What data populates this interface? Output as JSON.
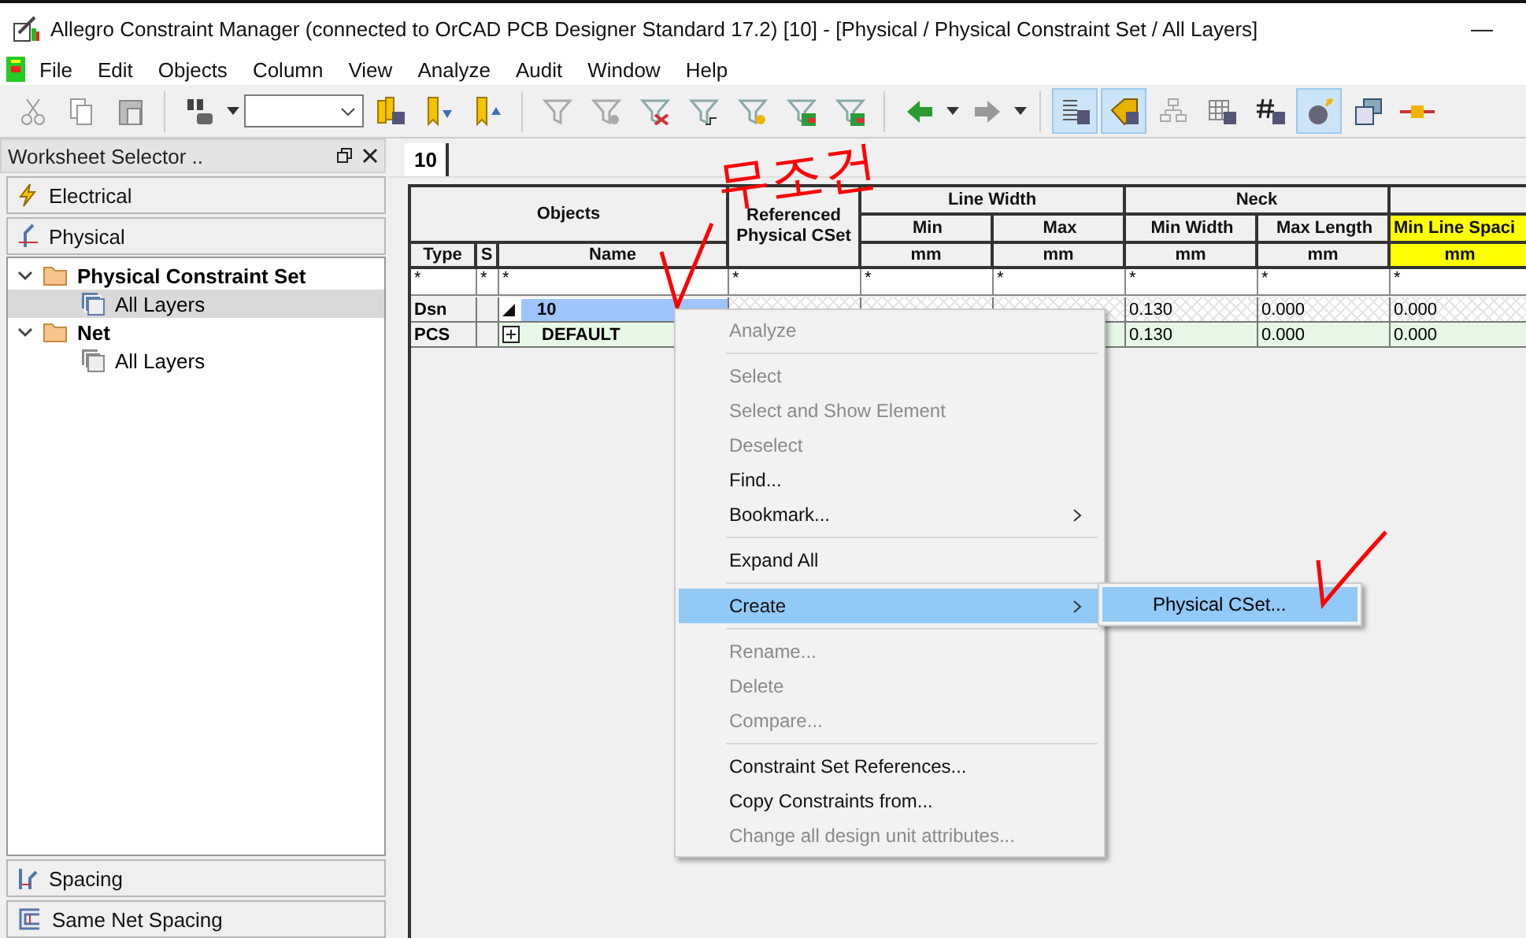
{
  "window": {
    "title": "Allegro Constraint Manager (connected to OrCAD PCB Designer Standard 17.2) [10] - [Physical / Physical Constraint Set / All Layers]",
    "minimize": "—"
  },
  "menu": [
    "File",
    "Edit",
    "Objects",
    "Column",
    "View",
    "Analyze",
    "Audit",
    "Window",
    "Help"
  ],
  "toolbar": [
    [
      {
        "kind": "cut",
        "pressed": false
      },
      {
        "kind": "copy",
        "pressed": false
      },
      {
        "kind": "paste",
        "pressed": false
      }
    ],
    [
      {
        "kind": "find",
        "pressed": false,
        "dropdown": true
      },
      {
        "kind": "combo"
      },
      {
        "kind": "bookmarks",
        "pressed": false
      },
      {
        "kind": "bookmarkdown",
        "pressed": false
      },
      {
        "kind": "bookmarkup",
        "pressed": false
      }
    ],
    [
      {
        "kind": "filter",
        "pressed": false
      },
      {
        "kind": "filterx",
        "pressed": false
      },
      {
        "kind": "filterred",
        "pressed": false
      },
      {
        "kind": "filterstep",
        "pressed": false
      },
      {
        "kind": "filterstar",
        "pressed": false
      },
      {
        "kind": "filtergrid",
        "pressed": false
      },
      {
        "kind": "filtergrid",
        "pressed": false
      }
    ],
    [
      {
        "kind": "back",
        "pressed": false,
        "dropdown": true
      },
      {
        "kind": "forward",
        "pressed": false,
        "dropdown": true
      }
    ],
    [
      {
        "kind": "sheet",
        "pressed": true
      },
      {
        "kind": "tag",
        "pressed": true
      },
      {
        "kind": "tree",
        "pressed": false
      },
      {
        "kind": "table",
        "pressed": false
      },
      {
        "kind": "hash",
        "pressed": false
      },
      {
        "kind": "bomb",
        "pressed": true
      },
      {
        "kind": "windows",
        "pressed": false
      },
      {
        "kind": "connector",
        "pressed": false
      }
    ]
  ],
  "worksheet_selector": {
    "title": "Worksheet Selector ..",
    "top_sections": [
      {
        "label": "Electrical",
        "kind": "electrical"
      },
      {
        "label": "Physical",
        "kind": "physical"
      }
    ],
    "tree": [
      {
        "label": "Physical Constraint Set",
        "expanded": true,
        "children": [
          {
            "label": "All Layers",
            "selected": true
          }
        ]
      },
      {
        "label": "Net",
        "expanded": true,
        "children": [
          {
            "label": "All Layers",
            "selected": false
          }
        ]
      }
    ],
    "bottom_sections": [
      {
        "label": "Spacing",
        "kind": "spacing"
      },
      {
        "label": "Same Net Spacing",
        "kind": "samenet"
      }
    ]
  },
  "tab": {
    "label": "10",
    "selected": true
  },
  "table": {
    "groups": [
      "Objects",
      "Referenced Physical CSet",
      "Line Width",
      "Neck"
    ],
    "object_columns": [
      "Type",
      "S",
      "Name"
    ],
    "columns": [
      {
        "label": "Min",
        "unit": "mm",
        "selected": false
      },
      {
        "label": "Max",
        "unit": "mm",
        "selected": false
      },
      {
        "label": "Min Width",
        "unit": "mm",
        "selected": false
      },
      {
        "label": "Max Length",
        "unit": "mm",
        "selected": false
      },
      {
        "label": "Min Line Spaci",
        "unit": "mm",
        "selected": true
      }
    ],
    "filters": [
      "*",
      "*",
      "*",
      "*",
      "*",
      "*",
      "*",
      "*",
      "*"
    ],
    "rows": [
      {
        "kind": "design",
        "type": "Dsn",
        "name": "10",
        "selected": true,
        "values": [
          "0.130",
          "0.000",
          "0.000"
        ]
      },
      {
        "kind": "cset",
        "type": "PCS",
        "name": "DEFAULT",
        "selected": false,
        "values": [
          "0.130",
          "0.000",
          "0.000"
        ]
      }
    ]
  },
  "context_menu": [
    {
      "kind": "item",
      "label": "Analyze",
      "disabled": true
    },
    {
      "kind": "separator"
    },
    {
      "kind": "item",
      "label": "Select",
      "disabled": true
    },
    {
      "kind": "item",
      "label": "Select and Show Element",
      "disabled": true
    },
    {
      "kind": "item",
      "label": "Deselect",
      "disabled": true
    },
    {
      "kind": "item",
      "label": "Find...",
      "disabled": false
    },
    {
      "kind": "submenu",
      "label": "Bookmark...",
      "disabled": false,
      "selected": false
    },
    {
      "kind": "separator"
    },
    {
      "kind": "item",
      "label": "Expand All",
      "disabled": false
    },
    {
      "kind": "separator"
    },
    {
      "kind": "submenu",
      "label": "Create",
      "disabled": false,
      "selected": true
    },
    {
      "kind": "separator"
    },
    {
      "kind": "item",
      "label": "Rename...",
      "disabled": true
    },
    {
      "kind": "item",
      "label": "Delete",
      "disabled": true
    },
    {
      "kind": "item",
      "label": "Compare...",
      "disabled": true
    },
    {
      "kind": "separator"
    },
    {
      "kind": "item",
      "label": "Constraint Set References...",
      "disabled": false
    },
    {
      "kind": "item",
      "label": "Copy Constraints from...",
      "disabled": false
    },
    {
      "kind": "item",
      "label": "Change all design unit attributes...",
      "disabled": true
    }
  ],
  "submenu": [
    {
      "label": "Physical CSet...",
      "selected": true
    }
  ],
  "annotation": {
    "text": "무조건"
  }
}
